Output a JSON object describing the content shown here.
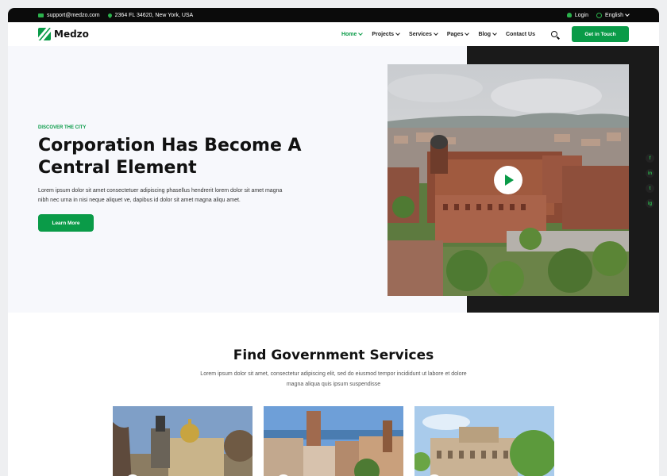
{
  "topbar": {
    "email": "support@medzo.com",
    "address": "2364 FL 34620, New York, USA",
    "login": "Login",
    "language": "English"
  },
  "nav": {
    "logo": "Medzo",
    "items": [
      "Home",
      "Projects",
      "Services",
      "Pages",
      "Blog",
      "Contact Us"
    ],
    "cta": "Get in Touch"
  },
  "hero": {
    "eyebrow": "DISCOVER THE CITY",
    "title": "Corporation Has Become A Central Element",
    "text": "Lorem ipsum dolor sit amet consectetuer adipiscing phasellus hendrerit lorem dolor sit amet magna nibh nec urna in nisi neque aliquet ve, dapibus id dolor sit amet magna aliqu amet.",
    "button": "Learn More",
    "social": [
      "f",
      "in",
      "t",
      "ig"
    ]
  },
  "services": {
    "title": "Find Government Services",
    "text": "Lorem ipsum dolor sit amet, consectetur adipiscing elit, sed do eiusmod tempor incididunt ut labore et dolore magna aliqua quis ipsum suspendisse"
  },
  "colors": {
    "brand": "#0a9b48",
    "dark": "#0b0b0b"
  }
}
